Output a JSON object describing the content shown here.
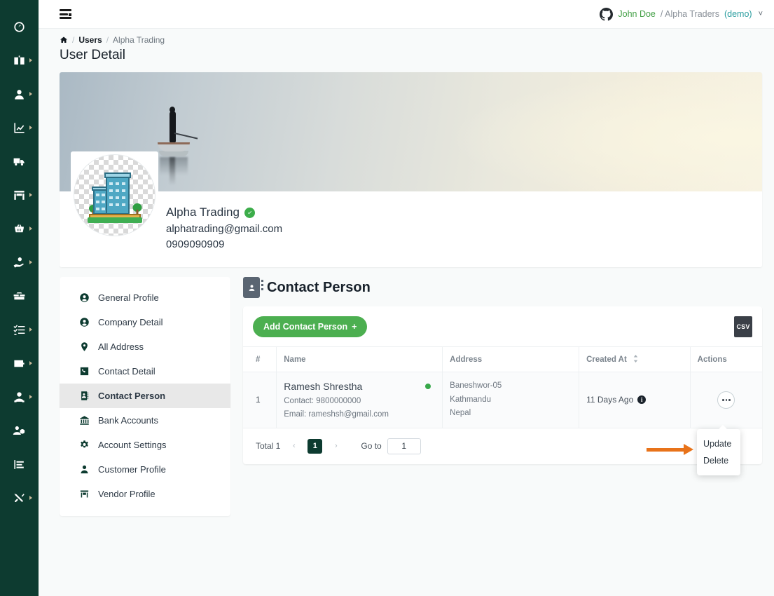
{
  "rail": {
    "items": [
      {
        "name": "dashboard",
        "icon": "speedometer-icon",
        "has_caret": false
      },
      {
        "name": "catalog",
        "icon": "book-open-icon",
        "has_caret": true
      },
      {
        "name": "users",
        "icon": "user-icon",
        "has_caret": true
      },
      {
        "name": "reports",
        "icon": "chart-line-icon",
        "has_caret": true
      },
      {
        "name": "delivery",
        "icon": "truck-icon",
        "has_caret": false
      },
      {
        "name": "store",
        "icon": "storefront-icon",
        "has_caret": true
      },
      {
        "name": "purchase",
        "icon": "basket-icon",
        "has_caret": true
      },
      {
        "name": "payments",
        "icon": "hand-coin-icon",
        "has_caret": true
      },
      {
        "name": "inventory",
        "icon": "boxes-icon",
        "has_caret": false
      },
      {
        "name": "tasks",
        "icon": "checklist-icon",
        "has_caret": true
      },
      {
        "name": "wallet",
        "icon": "wallet-icon",
        "has_caret": true
      },
      {
        "name": "customers",
        "icon": "user-group-icon",
        "has_caret": true
      },
      {
        "name": "hr",
        "icon": "people-settings-icon",
        "has_caret": false
      },
      {
        "name": "statements",
        "icon": "bar-report-icon",
        "has_caret": false
      },
      {
        "name": "tools",
        "icon": "tools-icon",
        "has_caret": true
      }
    ]
  },
  "topbar": {
    "menu_toggle": "menu-collapse-icon",
    "user": {
      "avatar_icon": "github-icon",
      "name": "John Doe",
      "separator": "/ Alpha Traders",
      "tenant_tag": "(demo)",
      "chevron": "˅"
    }
  },
  "breadcrumb": {
    "home_icon": "home-icon",
    "sep": "/",
    "items": [
      "Users",
      "Alpha Trading"
    ]
  },
  "page": {
    "title": "User Detail"
  },
  "profile": {
    "avatar_icon": "office-building-avatar",
    "name": "Alpha Trading",
    "verified": true,
    "email": "alphatrading@gmail.com",
    "phone": "0909090909"
  },
  "side_menu": {
    "items": [
      {
        "label": "General Profile",
        "icon": "user-circle-icon",
        "active": false
      },
      {
        "label": "Company Detail",
        "icon": "user-circle-icon",
        "active": false
      },
      {
        "label": "All Address",
        "icon": "map-pin-icon",
        "active": false
      },
      {
        "label": "Contact Detail",
        "icon": "phone-square-icon",
        "active": false
      },
      {
        "label": "Contact Person",
        "icon": "contact-card-icon",
        "active": true
      },
      {
        "label": "Bank Accounts",
        "icon": "bank-icon",
        "active": false
      },
      {
        "label": "Account Settings",
        "icon": "gear-icon",
        "active": false
      },
      {
        "label": "Customer Profile",
        "icon": "person-icon",
        "active": false
      },
      {
        "label": "Vendor Profile",
        "icon": "store-icon",
        "active": false
      }
    ]
  },
  "content": {
    "heading": "Contact Person",
    "heading_icon": "contact-card-icon",
    "add_button": "Add Contact Person",
    "add_button_plus": "+",
    "export_icon": "csv-file-icon",
    "export_label": "CSV",
    "table": {
      "columns": [
        "#",
        "Name",
        "Address",
        "Created At",
        "Actions"
      ],
      "sortable_column": "Created At",
      "rows": [
        {
          "index": "1",
          "name": "Ramesh Shrestha",
          "status_dot": "#37a84a",
          "contact": "Contact: 9800000000",
          "email": "Email: rameshsh@gmail.com",
          "address_lines": [
            "Baneshwor-05",
            "Kathmandu",
            "Nepal"
          ],
          "created_at": "11 Days Ago",
          "created_at_info_icon": "info-icon",
          "actions_icon": "ellipsis-icon"
        }
      ]
    },
    "pagination": {
      "total_label": "Total 1",
      "prev": "‹",
      "current_page": "1",
      "next": "›",
      "goto_label": "Go to",
      "goto_value": "1"
    },
    "row_menu": {
      "items": [
        "Update",
        "Delete"
      ],
      "annotation_arrow": "orange-arrow-pointing-to-update"
    }
  },
  "colors": {
    "rail_bg": "#0d3b30",
    "accent_green": "#4caf50",
    "brand_dark": "#0d3b30",
    "status_green": "#37a84a",
    "annotation_orange": "#e8731a",
    "user_name_green": "#44a047",
    "tenant_teal": "#2a9d9f"
  }
}
